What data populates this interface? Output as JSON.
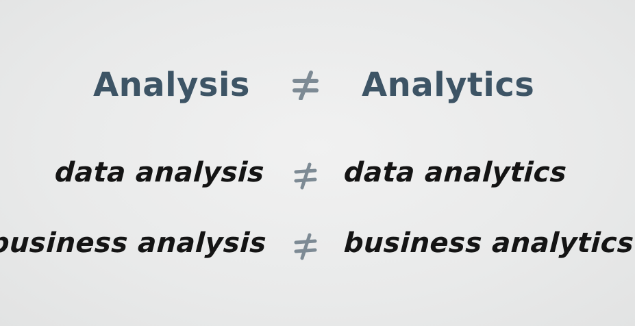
{
  "rows": [
    {
      "left": "Analysis",
      "symbol": "≠",
      "right": "Analytics"
    },
    {
      "left": "data analysis",
      "symbol": "≠",
      "right": "data analytics"
    },
    {
      "left": "business analysis",
      "symbol": "≠",
      "right": "business analytics"
    }
  ],
  "colors": {
    "title": "#3d5465",
    "handwriting": "#141414",
    "not_equal_sign": "#7d8a94",
    "background": "#ebebeb"
  }
}
